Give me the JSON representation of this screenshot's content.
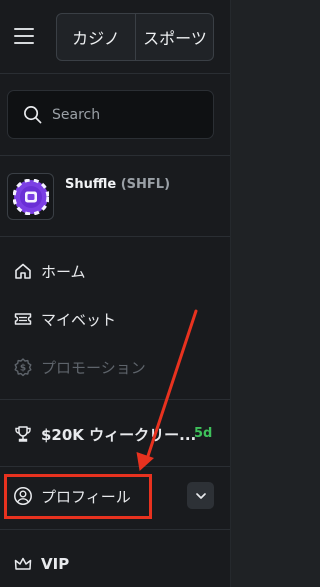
{
  "header": {
    "menu_icon": "hamburger-menu-icon",
    "tabs": [
      {
        "label": "カジノ"
      },
      {
        "label": "スポーツ"
      }
    ]
  },
  "search": {
    "placeholder": "Search",
    "value": "",
    "icon": "search-icon"
  },
  "token": {
    "name": "Shuffle",
    "ticker": "(SHFL)",
    "logo": "shuffle-chip-logo"
  },
  "nav": {
    "items": [
      {
        "label": "ホーム",
        "icon": "home-icon",
        "enabled": true
      },
      {
        "label": "マイベット",
        "icon": "ticket-icon",
        "enabled": true
      },
      {
        "label": "プロモーション",
        "icon": "promotion-icon",
        "enabled": false
      },
      {
        "label": "$20K ウィークリー...",
        "icon": "trophy-icon",
        "enabled": true,
        "badge": "5d"
      },
      {
        "label": "プロフィール",
        "icon": "user-circle-icon",
        "enabled": true,
        "expandable": true
      },
      {
        "label": "VIP",
        "icon": "crown-icon",
        "enabled": true
      }
    ]
  },
  "annotation": {
    "highlight_color": "#e8321f",
    "arrow_color": "#e8321f"
  },
  "colors": {
    "sidebar_bg": "#191b1e",
    "page_bg": "#1f2225",
    "badge_green": "#3ec15a",
    "token_purple": "#7b3fe4"
  }
}
